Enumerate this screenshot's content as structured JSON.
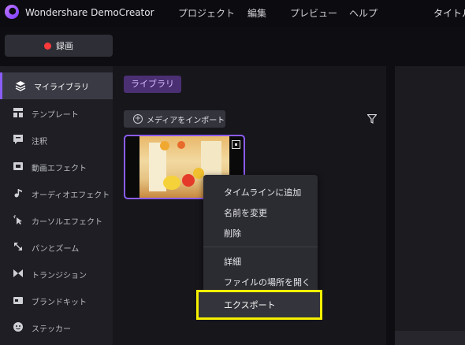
{
  "app": {
    "title": "Wondershare DemoCreator",
    "right_title": "タイトル"
  },
  "menu": [
    "プロジェクト",
    "編集",
    "プレビュー",
    "ヘルプ"
  ],
  "record_button": {
    "label": "録画"
  },
  "sidebar": {
    "items": [
      {
        "label": "マイライブラリ",
        "icon": "layers-icon",
        "active": true
      },
      {
        "label": "テンプレート",
        "icon": "template-icon"
      },
      {
        "label": "注釈",
        "icon": "annotation-icon"
      },
      {
        "label": "動画エフェクト",
        "icon": "video-effect-icon"
      },
      {
        "label": "オーディオエフェクト",
        "icon": "audio-effect-icon"
      },
      {
        "label": "カーソルエフェクト",
        "icon": "cursor-effect-icon"
      },
      {
        "label": "パンとズーム",
        "icon": "pan-zoom-icon"
      },
      {
        "label": "トランジション",
        "icon": "transition-icon"
      },
      {
        "label": "ブランドキット",
        "icon": "brand-kit-icon"
      },
      {
        "label": "ステッカー",
        "icon": "sticker-icon"
      }
    ]
  },
  "library": {
    "tab_label": "ライブラリ",
    "import_label": "メディアをインポート"
  },
  "context_menu": {
    "items": [
      "タイムラインに追加",
      "名前を変更",
      "削除",
      "詳細",
      "ファイルの場所を開く",
      "エクスポート"
    ],
    "highlighted": "エクスポート"
  },
  "colors": {
    "accent": "#8b5cf6",
    "highlight": "#f5f000",
    "record": "#ff3a3a"
  }
}
